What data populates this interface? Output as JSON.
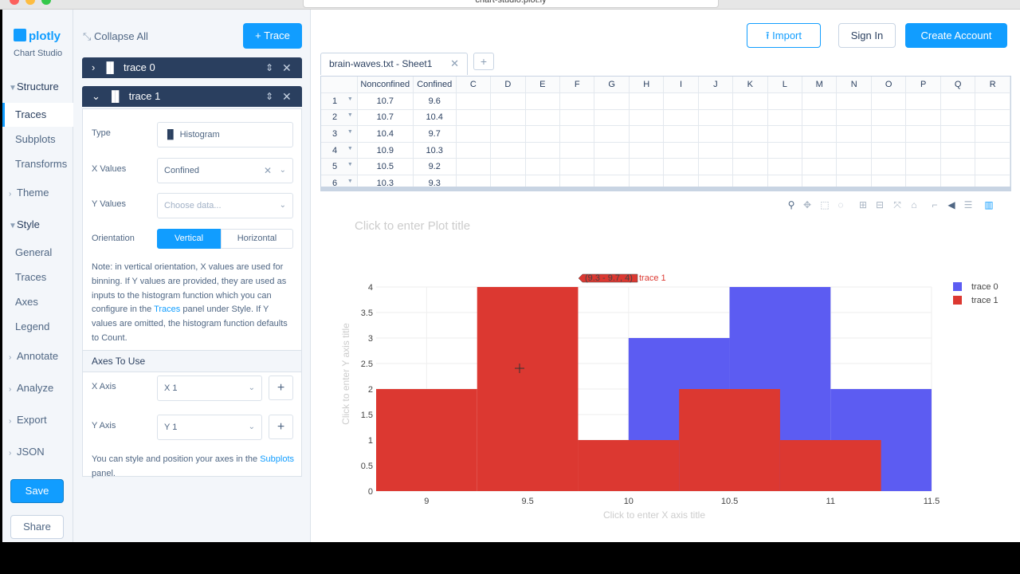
{
  "browser": {
    "url": "chart-studio.plot.ly"
  },
  "brand": {
    "name": "plotly",
    "sub": "Chart Studio"
  },
  "nav": {
    "structure": "Structure",
    "traces": "Traces",
    "subplots": "Subplots",
    "transforms": "Transforms",
    "theme": "Theme",
    "style": "Style",
    "general": "General",
    "style_traces": "Traces",
    "axes": "Axes",
    "legend": "Legend",
    "annotate": "Annotate",
    "analyze": "Analyze",
    "export": "Export",
    "json": "JSON",
    "save": "Save",
    "share": "Share"
  },
  "panel": {
    "collapse_all": "Collapse All",
    "add_trace": "+ Trace",
    "trace0": "trace 0",
    "trace1": "trace 1",
    "type_label": "Type",
    "type_value": "Histogram",
    "x_values_label": "X Values",
    "x_values_value": "Confined",
    "y_values_label": "Y Values",
    "y_values_placeholder": "Choose data...",
    "orientation_label": "Orientation",
    "orientation_vertical": "Vertical",
    "orientation_horizontal": "Horizontal",
    "note_a": "Note: in vertical orientation, X values are used for binning. If Y values are provided, they are used as inputs to the histogram function which you can configure in the ",
    "note_link": "Traces",
    "note_b": " panel under Style. If Y values are omitted, the histogram function defaults to Count.",
    "axes_to_use": "Axes To Use",
    "x_axis_label": "X Axis",
    "x_axis_value": "X 1",
    "y_axis_label": "Y Axis",
    "y_axis_value": "Y 1",
    "axes_note_a": "You can style and position your axes in the ",
    "axes_note_link": "Subplots",
    "axes_note_b": " panel."
  },
  "top": {
    "import": "Import",
    "signin": "Sign In",
    "create": "Create Account"
  },
  "sheet": {
    "tab_name": "brain-waves.txt - Sheet1",
    "columns": [
      "Nonconfined",
      "Confined",
      "C",
      "D",
      "E",
      "F",
      "G",
      "H",
      "I",
      "J",
      "K",
      "L",
      "M",
      "N",
      "O",
      "P",
      "Q",
      "R"
    ],
    "rows": [
      [
        "1",
        "10.7",
        "9.6"
      ],
      [
        "2",
        "10.7",
        "10.4"
      ],
      [
        "3",
        "10.4",
        "9.7"
      ],
      [
        "4",
        "10.9",
        "10.3"
      ],
      [
        "5",
        "10.5",
        "9.2"
      ],
      [
        "6",
        "10.3",
        "9.3"
      ]
    ]
  },
  "plot": {
    "title_placeholder": "Click to enter Plot title",
    "x_title_placeholder": "Click to enter X axis title",
    "y_title_placeholder": "Click to enter Y axis title",
    "hover_label": "(9.3 - 9.7, 4)",
    "hover_series": "trace 1"
  },
  "chart_data": {
    "type": "bar",
    "subtype": "histogram (overlay)",
    "xlim": [
      8.75,
      11.5
    ],
    "ylim": [
      0,
      4
    ],
    "x_ticks": [
      "9",
      "9.5",
      "10",
      "10.5",
      "11",
      "11.5"
    ],
    "y_ticks": [
      "0",
      "0.5",
      "1",
      "1.5",
      "2",
      "2.5",
      "3",
      "3.5",
      "4"
    ],
    "legend_placement": "top-right",
    "grid": true,
    "series": [
      {
        "name": "trace 0",
        "color": "#5c5cf2",
        "bin_starts": [
          9.0,
          9.5,
          10.0,
          10.5,
          11.0
        ],
        "bin_width": 0.5,
        "values": [
          0,
          0,
          3,
          4,
          2
        ]
      },
      {
        "name": "trace 1",
        "color": "#dc3831",
        "bin_starts": [
          8.75,
          9.25,
          9.75,
          10.25,
          10.75
        ],
        "bin_width": 0.5,
        "values": [
          2,
          4,
          1,
          2,
          1
        ]
      }
    ]
  }
}
